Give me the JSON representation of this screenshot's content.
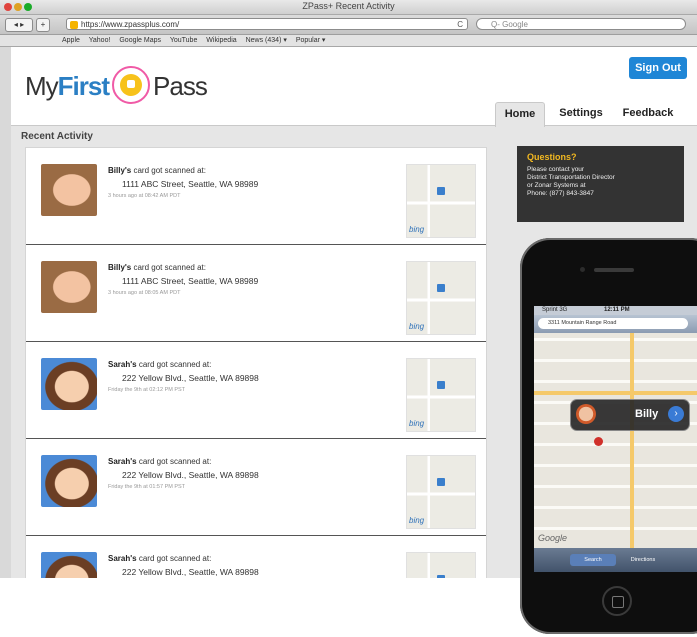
{
  "browser": {
    "window_title": "ZPass+ Recent Activity",
    "url": "https://www.zpassplus.com/",
    "search_placeholder": "Q- Google",
    "nav_back": "◂ ▸",
    "nav_add": "+",
    "reload": "C",
    "bookmarks": [
      "Apple",
      "Yahoo!",
      "Google Maps",
      "YouTube",
      "Wikipedia",
      "News (434) ▾",
      "Popular ▾"
    ]
  },
  "app": {
    "logo_my": "My",
    "logo_first": "First",
    "logo_pass": "Pass",
    "sign_out": "Sign Out",
    "tabs": [
      "Home",
      "Settings",
      "Feedback"
    ],
    "section_title": "Recent Activity",
    "activities": [
      {
        "name": "Billy's",
        "action": "card got scanned at:",
        "address": "1111 ABC Street, Seattle, WA 98989",
        "time": "3 hours ago at 08:42 AM PDT",
        "photo": "boy"
      },
      {
        "name": "Billy's",
        "action": "card got scanned at:",
        "address": "1111 ABC Street, Seattle, WA 98989",
        "time": "3 hours ago at 08:05 AM PDT",
        "photo": "boy"
      },
      {
        "name": "Sarah's",
        "action": "card got scanned at:",
        "address": "222 Yellow Blvd., Seattle, WA 89898",
        "time": "Friday the 9th at 02:12 PM PST",
        "photo": "girl"
      },
      {
        "name": "Sarah's",
        "action": "card got scanned at:",
        "address": "222 Yellow Blvd., Seattle, WA 89898",
        "time": "Friday the 9th at 01:57 PM PST",
        "photo": "girl"
      },
      {
        "name": "Sarah's",
        "action": "card got scanned at:",
        "address": "222 Yellow Blvd., Seattle, WA 89898",
        "time": "",
        "photo": "girl"
      }
    ],
    "map_brand": "bing",
    "questions": {
      "title": "Questions?",
      "body_lines": [
        "Please contact your",
        "District Transportation Director",
        "or Zonar Systems at",
        "Phone: (877) 843-3847"
      ]
    }
  },
  "phone": {
    "carrier": "Sprint 3G",
    "clock": "12:11 PM",
    "search_value": "3311 Mountain Range Road",
    "callout_name": "Billy",
    "map_logo": "Google",
    "tab_search": "Search",
    "tab_directions": "Directions"
  },
  "colors": {
    "accent_blue": "#1f86d6",
    "questions_yellow": "#f2b821",
    "logo_pink": "#f05aa6"
  }
}
